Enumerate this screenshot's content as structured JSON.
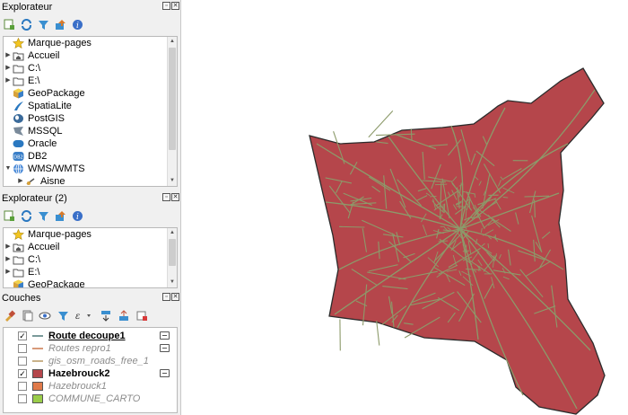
{
  "colors": {
    "commune_fill": "#b5464b",
    "commune_stroke": "#2b2b2b",
    "roads": "#8c9a6a",
    "route_line": "#7a9a9a",
    "routes_repro_line": "#d89a7a",
    "osm_roads_line": "#c9b28a",
    "hazebrouck2_fill": "#b5464b",
    "hazebrouck1_fill": "#e07a4a",
    "commune_carto_fill": "#9acd4a"
  },
  "browser": {
    "title": "Explorateur",
    "toolbar": [
      "add-layer-icon",
      "refresh-icon",
      "filter-icon",
      "collapse-icon",
      "info-icon"
    ],
    "items": [
      {
        "label": "Marque-pages",
        "icon": "star-icon",
        "expand": false
      },
      {
        "label": "Accueil",
        "icon": "home-folder-icon",
        "expand": true
      },
      {
        "label": "C:\\",
        "icon": "folder-icon",
        "expand": true
      },
      {
        "label": "E:\\",
        "icon": "folder-icon",
        "expand": true
      },
      {
        "label": "GeoPackage",
        "icon": "geopackage-icon",
        "expand": false
      },
      {
        "label": "SpatiaLite",
        "icon": "spatialite-icon",
        "expand": false
      },
      {
        "label": "PostGIS",
        "icon": "postgis-icon",
        "expand": false
      },
      {
        "label": "MSSQL",
        "icon": "mssql-icon",
        "expand": false
      },
      {
        "label": "Oracle",
        "icon": "oracle-icon",
        "expand": false
      },
      {
        "label": "DB2",
        "icon": "db2-icon",
        "expand": false
      },
      {
        "label": "WMS/WMTS",
        "icon": "wms-icon",
        "expand": true
      },
      {
        "label": "Aisne",
        "icon": "wms-layer-icon",
        "expand": true
      }
    ]
  },
  "browser2": {
    "title": "Explorateur (2)",
    "items": [
      {
        "label": "Marque-pages",
        "icon": "star-icon"
      },
      {
        "label": "Accueil",
        "icon": "home-folder-icon"
      },
      {
        "label": "C:\\",
        "icon": "folder-icon"
      },
      {
        "label": "E:\\",
        "icon": "folder-icon"
      },
      {
        "label": "GeoPackage",
        "icon": "geopackage-icon"
      }
    ]
  },
  "layers": {
    "title": "Couches",
    "items": [
      {
        "label": "Route decoupe1",
        "checked": true,
        "style": "line",
        "emphasis": "bold-underline",
        "filter": true
      },
      {
        "label": "Routes repro1",
        "checked": false,
        "style": "line",
        "emphasis": "dim",
        "filter": true
      },
      {
        "label": "gis_osm_roads_free_1",
        "checked": false,
        "style": "line",
        "emphasis": "dim",
        "filter": false
      },
      {
        "label": "Hazebrouck2",
        "checked": true,
        "style": "polygon",
        "emphasis": "bold",
        "filter": true
      },
      {
        "label": "Hazebrouck1",
        "checked": false,
        "style": "polygon",
        "emphasis": "dim",
        "filter": false
      },
      {
        "label": "COMMUNE_CARTO",
        "checked": false,
        "style": "polygon",
        "emphasis": "dim",
        "filter": false
      }
    ]
  }
}
